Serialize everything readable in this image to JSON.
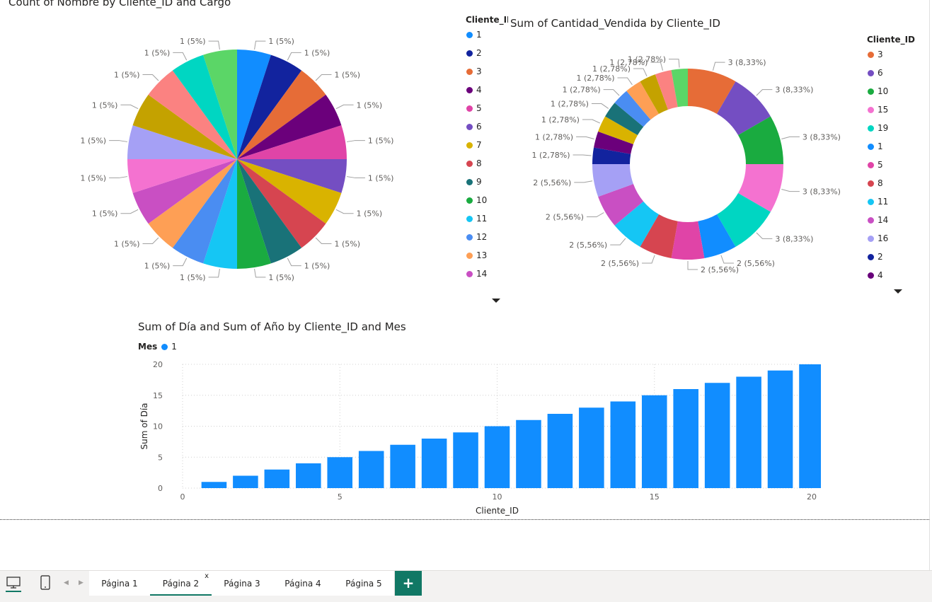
{
  "colors": {
    "palette": [
      "#118DFF",
      "#12239E",
      "#E66C37",
      "#6B007B",
      "#E044A7",
      "#744EC2",
      "#D9B300",
      "#D64550",
      "#197278",
      "#1AAB40",
      "#15C6F4",
      "#4A8DF2",
      "#FE9F55",
      "#C94FC3",
      "#A5A0F5",
      "#1E2C84",
      "#68007A",
      "#FB8281",
      "#00D6C2",
      "#5BD667"
    ],
    "bar": "#118DFF",
    "accent": "#117865"
  },
  "chart_data": [
    {
      "type": "pie",
      "title": "Count of Nombre by Cliente_ID and Cargo",
      "slices": [
        {
          "category": "1",
          "value": 1,
          "label": "1 (5%)",
          "color": "#118DFF"
        },
        {
          "category": "2",
          "value": 1,
          "label": "1 (5%)",
          "color": "#12239E"
        },
        {
          "category": "3",
          "value": 1,
          "label": "1 (5%)",
          "color": "#E66C37"
        },
        {
          "category": "4",
          "value": 1,
          "label": "1 (5%)",
          "color": "#6B007B"
        },
        {
          "category": "5",
          "value": 1,
          "label": "1 (5%)",
          "color": "#E044A7"
        },
        {
          "category": "6",
          "value": 1,
          "label": "1 (5%)",
          "color": "#744EC2"
        },
        {
          "category": "7",
          "value": 1,
          "label": "1 (5%)",
          "color": "#D9B300"
        },
        {
          "category": "8",
          "value": 1,
          "label": "1 (5%)",
          "color": "#D64550"
        },
        {
          "category": "9",
          "value": 1,
          "label": "1 (5%)",
          "color": "#197278"
        },
        {
          "category": "10",
          "value": 1,
          "label": "1 (5%)",
          "color": "#1AAB40"
        },
        {
          "category": "11",
          "value": 1,
          "label": "1 (5%)",
          "color": "#15C6F4"
        },
        {
          "category": "12",
          "value": 1,
          "label": "1 (5%)",
          "color": "#4A8DF2"
        },
        {
          "category": "13",
          "value": 1,
          "label": "1 (5%)",
          "color": "#FE9F55"
        },
        {
          "category": "14",
          "value": 1,
          "label": "1 (5%)",
          "color": "#C94FC3"
        },
        {
          "category": "15",
          "value": 1,
          "label": "1 (5%)",
          "color": "#F472D0"
        },
        {
          "category": "16",
          "value": 1,
          "label": "1 (5%)",
          "color": "#A5A0F5"
        },
        {
          "category": "17",
          "value": 1,
          "label": "1 (5%)",
          "color": "#C4A200"
        },
        {
          "category": "18",
          "value": 1,
          "label": "1 (5%)",
          "color": "#FB8281"
        },
        {
          "category": "19",
          "value": 1,
          "label": "1 (5%)",
          "color": "#00D6C2"
        },
        {
          "category": "20",
          "value": 1,
          "label": "1 (5%)",
          "color": "#5BD667"
        }
      ],
      "legend": {
        "title": "Cliente_II",
        "placement": "right",
        "items": [
          {
            "label": "1",
            "color": "#118DFF"
          },
          {
            "label": "2",
            "color": "#12239E"
          },
          {
            "label": "3",
            "color": "#E66C37"
          },
          {
            "label": "4",
            "color": "#6B007B"
          },
          {
            "label": "5",
            "color": "#E044A7"
          },
          {
            "label": "6",
            "color": "#744EC2"
          },
          {
            "label": "7",
            "color": "#D9B300"
          },
          {
            "label": "8",
            "color": "#D64550"
          },
          {
            "label": "9",
            "color": "#197278"
          },
          {
            "label": "10",
            "color": "#1AAB40"
          },
          {
            "label": "11",
            "color": "#15C6F4"
          },
          {
            "label": "12",
            "color": "#4A8DF2"
          },
          {
            "label": "13",
            "color": "#FE9F55"
          },
          {
            "label": "14",
            "color": "#C94FC3"
          }
        ]
      }
    },
    {
      "type": "donut",
      "title": "Sum of Cantidad_Vendida by Cliente_ID",
      "slices": [
        {
          "category": "3",
          "value": 3,
          "label": "3 (8,33%)",
          "color": "#E66C37"
        },
        {
          "category": "6",
          "value": 3,
          "label": "3 (8,33%)",
          "color": "#744EC2"
        },
        {
          "category": "10",
          "value": 3,
          "label": "3 (8,33%)",
          "color": "#1AAB40"
        },
        {
          "category": "15",
          "value": 3,
          "label": "3 (8,33%)",
          "color": "#F472D0"
        },
        {
          "category": "19",
          "value": 3,
          "label": "3 (8,33%)",
          "color": "#00D6C2"
        },
        {
          "category": "1",
          "value": 2,
          "label": "2 (5,56%)",
          "color": "#118DFF"
        },
        {
          "category": "5",
          "value": 2,
          "label": "2 (5,56%)",
          "color": "#E044A7"
        },
        {
          "category": "8",
          "value": 2,
          "label": "2 (5,56%)",
          "color": "#D64550"
        },
        {
          "category": "11",
          "value": 2,
          "label": "2 (5,56%)",
          "color": "#15C6F4"
        },
        {
          "category": "14",
          "value": 2,
          "label": "2 (5,56%)",
          "color": "#C94FC3"
        },
        {
          "category": "16",
          "value": 2,
          "label": "2 (5,56%)",
          "color": "#A5A0F5"
        },
        {
          "category": "2",
          "value": 1,
          "label": "1 (2,78%)",
          "color": "#12239E"
        },
        {
          "category": "4",
          "value": 1,
          "label": "1 (2,78%)",
          "color": "#6B007B"
        },
        {
          "category": "7",
          "value": 1,
          "label": "1 (2,78%)",
          "color": "#D9B300"
        },
        {
          "category": "9",
          "value": 1,
          "label": "1 (2,78%)",
          "color": "#197278"
        },
        {
          "category": "12",
          "value": 1,
          "label": "1 (2,78%)",
          "color": "#4A8DF2"
        },
        {
          "category": "13",
          "value": 1,
          "label": "1 (2,78%)",
          "color": "#FE9F55"
        },
        {
          "category": "17",
          "value": 1,
          "label": "1 (2,78%)",
          "color": "#C4A200"
        },
        {
          "category": "18",
          "value": 1,
          "label": "1 (2,78%)",
          "color": "#FB8281"
        },
        {
          "category": "20",
          "value": 1,
          "label": "1 (2,78%)",
          "color": "#5BD667"
        }
      ],
      "legend": {
        "title": "Cliente_ID",
        "placement": "right",
        "items": [
          {
            "label": "3",
            "color": "#E66C37"
          },
          {
            "label": "6",
            "color": "#744EC2"
          },
          {
            "label": "10",
            "color": "#1AAB40"
          },
          {
            "label": "15",
            "color": "#F472D0"
          },
          {
            "label": "19",
            "color": "#00D6C2"
          },
          {
            "label": "1",
            "color": "#118DFF"
          },
          {
            "label": "5",
            "color": "#E044A7"
          },
          {
            "label": "8",
            "color": "#D64550"
          },
          {
            "label": "11",
            "color": "#15C6F4"
          },
          {
            "label": "14",
            "color": "#C94FC3"
          },
          {
            "label": "16",
            "color": "#A5A0F5"
          },
          {
            "label": "2",
            "color": "#12239E"
          },
          {
            "label": "4",
            "color": "#68007A"
          }
        ]
      }
    },
    {
      "type": "bar",
      "title": "Sum of Día and Sum of Año by Cliente_ID and Mes",
      "xlabel": "Cliente_ID",
      "ylabel": "Sum of Día",
      "legend": {
        "title": "Mes",
        "placement": "top-left",
        "items": [
          {
            "label": "1",
            "color": "#118DFF"
          }
        ]
      },
      "x": [
        1,
        2,
        3,
        4,
        5,
        6,
        7,
        8,
        9,
        10,
        11,
        12,
        13,
        14,
        15,
        16,
        17,
        18,
        19,
        20
      ],
      "series": [
        {
          "name": "1",
          "values": [
            1,
            2,
            3,
            4,
            5,
            6,
            7,
            8,
            9,
            10,
            11,
            12,
            13,
            14,
            15,
            16,
            17,
            18,
            19,
            20
          ]
        }
      ],
      "xlim": [
        0,
        20
      ],
      "ylim": [
        0,
        20
      ],
      "xticks": [
        "0",
        "5",
        "10",
        "15",
        "20"
      ],
      "yticks": [
        "0",
        "5",
        "10",
        "15",
        "20"
      ],
      "grid": true
    }
  ],
  "tabs": [
    {
      "label": "Página 1",
      "active": false
    },
    {
      "label": "Página 2",
      "active": true
    },
    {
      "label": "Página 3",
      "active": false
    },
    {
      "label": "Página 4",
      "active": false
    },
    {
      "label": "Página 5",
      "active": false
    }
  ],
  "tab_close_label": "x",
  "add_tab_label": "+"
}
